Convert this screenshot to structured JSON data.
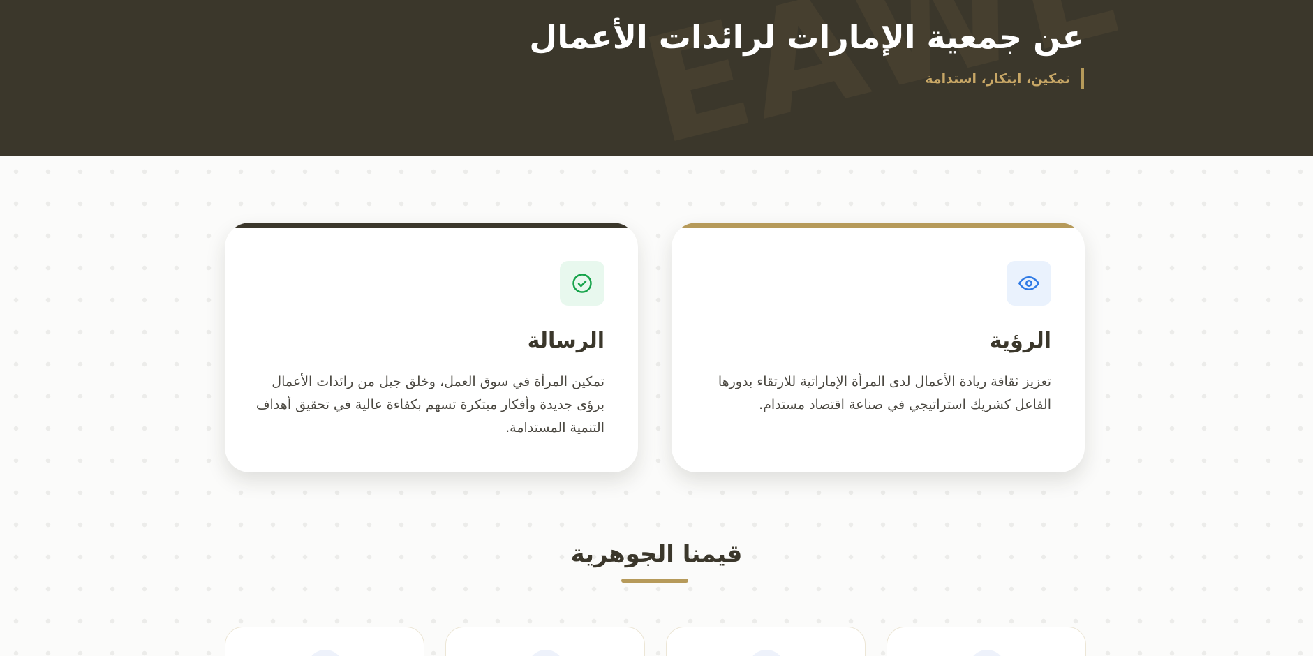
{
  "header": {
    "title": "عن جمعية الإمارات لرائدات الأعمال",
    "tagline": "تمكين، ابتكار، استدامة",
    "watermark": "EAWE"
  },
  "cards": {
    "vision": {
      "icon": "eye-icon",
      "title": "الرؤية",
      "text": "تعزيز ثقافة ريادة الأعمال لدى المرأة الإماراتية للارتقاء بدورها الفاعل كشريك استراتيجي في صناعة اقتصاد مستدام."
    },
    "mission": {
      "icon": "check-circle-icon",
      "title": "الرسالة",
      "text": "تمكين المرأة في سوق العمل، وخلق جيل من رائدات الأعمال برؤى جديدة وأفكار مبتكرة تسهم بكفاءة عالية في تحقيق أهداف التنمية المستدامة."
    }
  },
  "values": {
    "title": "قيمنا الجوهرية"
  },
  "colors": {
    "header_bg": "#3b372b",
    "gold": "#b69a5a",
    "vision_icon": "#2f7ae5",
    "mission_icon": "#16a34a"
  }
}
